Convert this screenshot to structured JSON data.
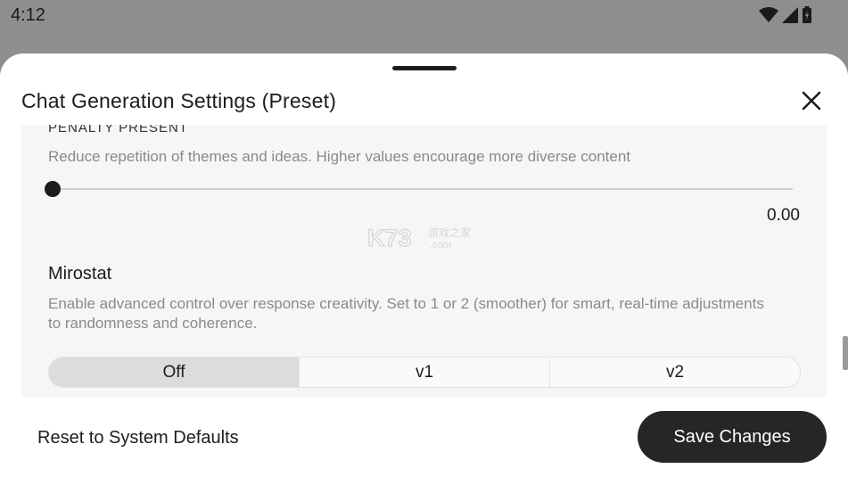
{
  "status_bar": {
    "time": "4:12",
    "icons": [
      "wifi-icon",
      "signal-icon",
      "battery-icon"
    ]
  },
  "sheet": {
    "title": "Chat Generation Settings (Preset)",
    "close_icon": "close-icon"
  },
  "penalty_present": {
    "label": "PENALTY PRESENT",
    "description": "Reduce repetition of themes and ideas. Higher values encourage more diverse content",
    "value_text": "0.00",
    "slider_fraction": 0.0
  },
  "mirostat": {
    "title": "Mirostat",
    "description": "Enable advanced control over response creativity. Set to 1 or 2 (smoother) for smart, real-time adjustments to randomness and coherence.",
    "options": [
      "Off",
      "v1",
      "v2"
    ],
    "selected": "Off"
  },
  "watermark": {
    "text": "K73",
    "sub_text": "游戏之家",
    "domain_text": ".com"
  },
  "footer": {
    "reset_label": "Reset to System Defaults",
    "save_label": "Save Changes"
  },
  "colors": {
    "scrim": "#8e8e8e",
    "sheet_bg": "#ffffff",
    "panel_bg": "#f6f6f6",
    "primary_button": "#262626",
    "selected_segment": "#dcdcdc"
  }
}
